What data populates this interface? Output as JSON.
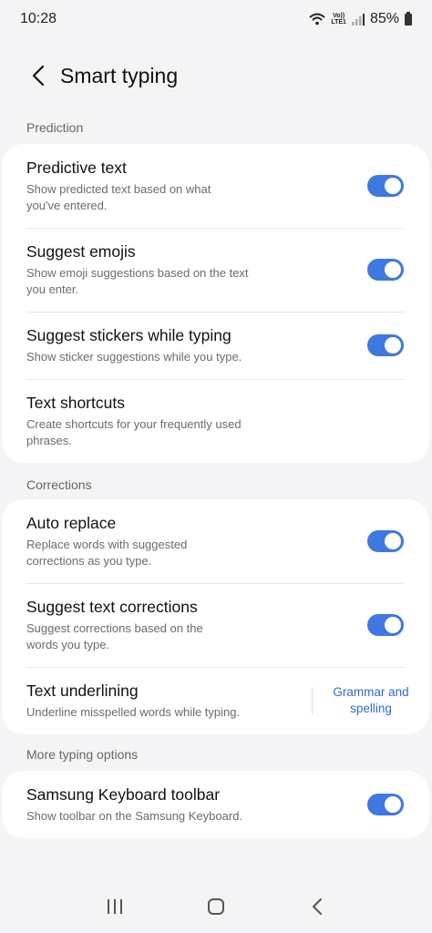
{
  "status": {
    "time": "10:28",
    "volte_top": "Vo))",
    "volte_bottom": "LTE1",
    "battery": "85%"
  },
  "header": {
    "title": "Smart typing"
  },
  "sections": {
    "prediction": {
      "label": "Prediction",
      "items": [
        {
          "title": "Predictive text",
          "subtitle": "Show predicted text based on what you've entered.",
          "toggle": true
        },
        {
          "title": "Suggest emojis",
          "subtitle": "Show emoji suggestions based on the text you enter.",
          "toggle": true
        },
        {
          "title": "Suggest stickers while typing",
          "subtitle": "Show sticker suggestions while you type.",
          "toggle": true
        },
        {
          "title": "Text shortcuts",
          "subtitle": "Create shortcuts for your frequently used phrases."
        }
      ]
    },
    "corrections": {
      "label": "Corrections",
      "items": [
        {
          "title": "Auto replace",
          "subtitle": "Replace words with suggested corrections as you type.",
          "toggle": true
        },
        {
          "title": "Suggest text corrections",
          "subtitle": "Suggest corrections based on the words you type.",
          "toggle": true
        },
        {
          "title": "Text underlining",
          "subtitle": "Underline misspelled words while typing.",
          "link": "Grammar and spelling"
        }
      ]
    },
    "more": {
      "label": "More typing options",
      "items": [
        {
          "title": "Samsung Keyboard toolbar",
          "subtitle": "Show toolbar on the Samsung Keyboard.",
          "toggle": true
        }
      ]
    }
  },
  "colors": {
    "accent": "#3e78e0",
    "link": "#2f6ad8",
    "background": "#f4f4f6"
  },
  "nav": {
    "icons": [
      "recent-apps-icon",
      "home-icon",
      "back-icon"
    ]
  }
}
